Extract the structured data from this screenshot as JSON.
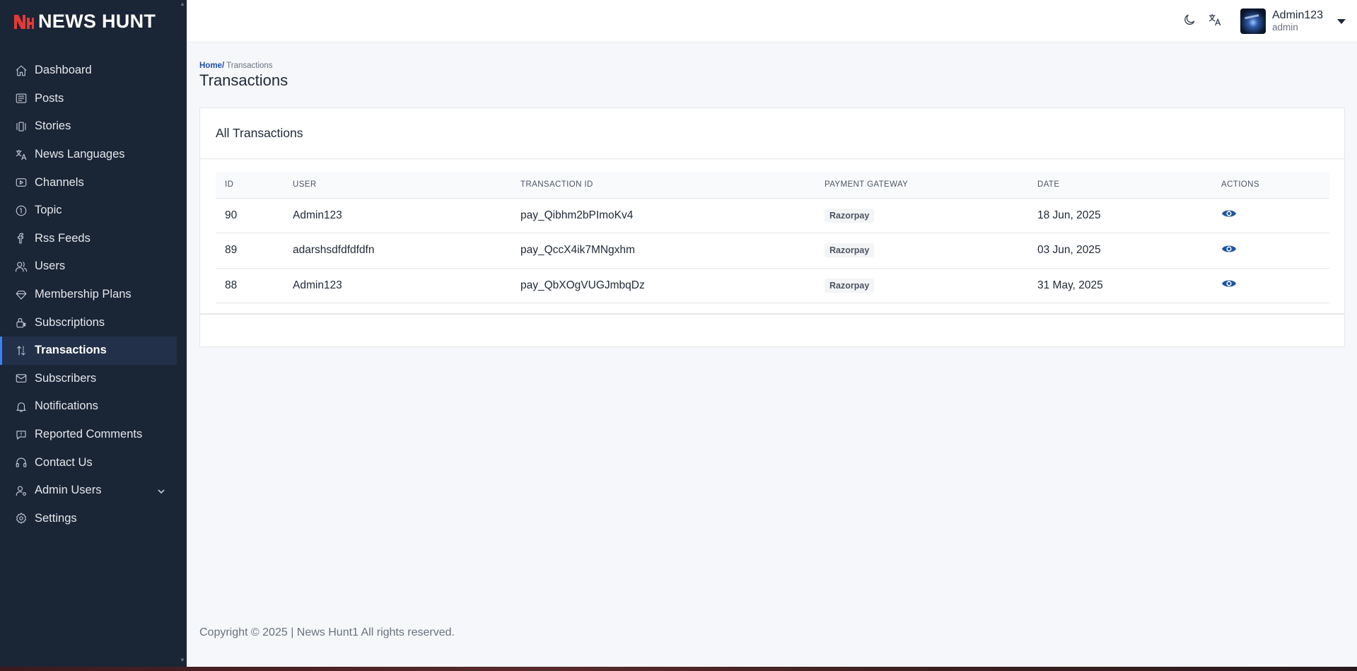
{
  "brand": {
    "name": "NEWS HUNT",
    "mark_color": "#e53935"
  },
  "sidebar": {
    "items": [
      {
        "label": "Dashboard",
        "icon": "home-icon"
      },
      {
        "label": "Posts",
        "icon": "newspaper-icon"
      },
      {
        "label": "Stories",
        "icon": "stories-icon"
      },
      {
        "label": "News Languages",
        "icon": "translate-icon"
      },
      {
        "label": "Channels",
        "icon": "play-square-icon"
      },
      {
        "label": "Topic",
        "icon": "info-circle-icon"
      },
      {
        "label": "Rss Feeds",
        "icon": "rss-icon"
      },
      {
        "label": "Users",
        "icon": "users-icon"
      },
      {
        "label": "Membership Plans",
        "icon": "diamond-icon"
      },
      {
        "label": "Subscriptions",
        "icon": "lock-dollar-icon"
      },
      {
        "label": "Transactions",
        "icon": "arrows-updown-icon",
        "active": true
      },
      {
        "label": "Subscribers",
        "icon": "mail-icon"
      },
      {
        "label": "Notifications",
        "icon": "bell-icon"
      },
      {
        "label": "Reported Comments",
        "icon": "alert-message-icon"
      },
      {
        "label": "Contact Us",
        "icon": "headset-icon"
      },
      {
        "label": "Admin Users",
        "icon": "user-gear-icon",
        "has_submenu": true
      },
      {
        "label": "Settings",
        "icon": "gear-icon"
      }
    ]
  },
  "header": {
    "user_name": "Admin123",
    "user_role": "admin",
    "theme_icon": "moon-icon",
    "language_icon": "translate-icon"
  },
  "breadcrumb": {
    "home": "Home/",
    "current": " Transactions"
  },
  "page_title": "Transactions",
  "card": {
    "title": "All Transactions",
    "columns": [
      "ID",
      "USER",
      "TRANSACTION ID",
      "PAYMENT GATEWAY",
      "DATE",
      "ACTIONS"
    ],
    "rows": [
      {
        "id": "90",
        "user": "Admin123",
        "transaction_id": "pay_Qibhm2bPImoKv4",
        "gateway": "Razorpay",
        "date": "18 Jun, 2025"
      },
      {
        "id": "89",
        "user": "adarshsdfdfdfdfn",
        "transaction_id": "pay_QccX4ik7MNgxhm",
        "gateway": "Razorpay",
        "date": "03 Jun, 2025"
      },
      {
        "id": "88",
        "user": "Admin123",
        "transaction_id": "pay_QbXOgVUGJmbqDz",
        "gateway": "Razorpay",
        "date": "31 May, 2025"
      }
    ]
  },
  "footer": {
    "text": "Copyright © 2025 | News Hunt1 All rights reserved."
  },
  "colors": {
    "sidebar_bg": "#1a2536",
    "accent": "#1e4fa3",
    "view_icon": "#1e56a0"
  }
}
